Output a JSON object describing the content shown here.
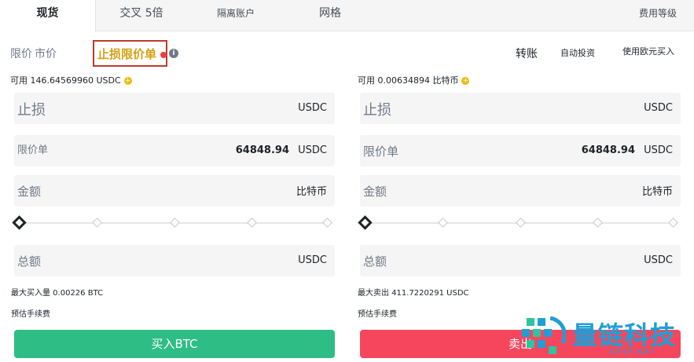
{
  "tabs": [
    {
      "label": "现货",
      "active": true
    },
    {
      "label": "交叉 5倍",
      "active": false
    },
    {
      "label": "隔离账户",
      "active": false
    },
    {
      "label": "网格",
      "active": false
    }
  ],
  "fee_level": "费用等级",
  "order_types": {
    "limit": "限价",
    "market": "市价",
    "stop_limit": "止损限价单"
  },
  "links": {
    "transfer": "转账",
    "auto_invest": "自动投资",
    "buy_with_eur": "使用欧元买入"
  },
  "buy": {
    "available": "可用 146.64569960 USDC",
    "stop_label": "止损",
    "stop_unit": "USDC",
    "limit_label": "限价单",
    "limit_value": "64848.94",
    "limit_unit": "USDC",
    "amount_label": "金额",
    "amount_unit": "比特币",
    "total_label": "总额",
    "total_unit": "USDC",
    "max_line": "最大买入量 0.00226 BTC",
    "fee_line": "预估手续费",
    "button": "买入BTC"
  },
  "sell": {
    "available": "可用 0.00634894 比特币",
    "stop_label": "止损",
    "stop_unit": "USDC",
    "limit_label": "限价单",
    "limit_value": "64848.94",
    "limit_unit": "USDC",
    "amount_label": "金额",
    "amount_unit": "比特币",
    "total_label": "总额",
    "total_unit": "USDC",
    "max_line": "最大卖出 411.7220291 USDC",
    "fee_line": "预估手续费",
    "button": "卖出"
  },
  "watermark": {
    "name": "量链科技",
    "site": "QFSP.NET"
  },
  "colors": {
    "buy": "#2ebd85",
    "sell": "#f6465d",
    "accent": "#d4a012",
    "highlight_border": "#c0392b"
  }
}
